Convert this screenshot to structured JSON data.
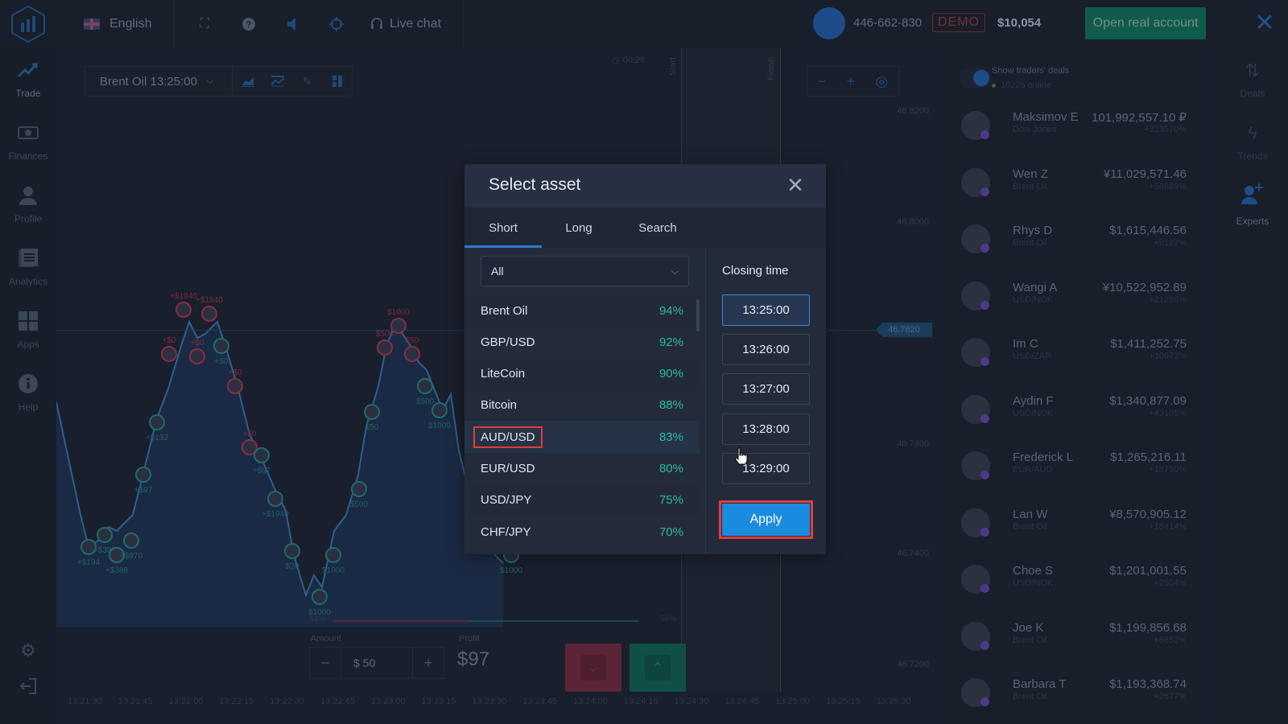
{
  "topbar": {
    "language": "English",
    "live_chat": "Live chat",
    "account_id": "446-662-830",
    "account_mode": "DEMO",
    "balance": "$10,054",
    "open_real_account": "Open real account",
    "icons": [
      "logo-icon",
      "flag-uk-icon",
      "fullscreen-icon",
      "help-icon",
      "sound-icon",
      "target-icon",
      "headset-icon",
      "close-icon"
    ]
  },
  "sidebar": {
    "items": [
      {
        "label": "Trade",
        "icon": "trade-icon",
        "active": true
      },
      {
        "label": "Finances",
        "icon": "finances-icon"
      },
      {
        "label": "Profile",
        "icon": "profile-icon"
      },
      {
        "label": "Analytics",
        "icon": "analytics-icon"
      },
      {
        "label": "Apps",
        "icon": "apps-icon"
      },
      {
        "label": "Help",
        "icon": "help-icon"
      }
    ],
    "bottom_icons": [
      "settings-icon",
      "logout-icon"
    ]
  },
  "chart": {
    "asset_selector": "Brent Oil 13:25:00",
    "timer": "00:26",
    "start_label": "Start",
    "finish_label": "Finish",
    "current_price": "46.7820",
    "price_labels": [
      "46.8200",
      "46.8000",
      "46.7600",
      "46.7400",
      "46.7200"
    ],
    "time_labels": [
      "13:21:30",
      "13:21:45",
      "13:22:00",
      "13:22:15",
      "13:22:30",
      "13:22:45",
      "13:23:00",
      "13:23:15",
      "13:23:30",
      "13:23:45",
      "13:24:00",
      "13:24:15",
      "13:24:30",
      "13:24:45",
      "13:25:00",
      "13:25:15",
      "13:25:30"
    ],
    "deal_labels": [
      {
        "text": "+$1940",
        "kind": "down"
      },
      {
        "text": "+$1940",
        "kind": "down"
      },
      {
        "text": "+$0",
        "kind": "down"
      },
      {
        "text": "+$0",
        "kind": "down"
      },
      {
        "text": "+$0",
        "kind": "up"
      },
      {
        "text": "+$0",
        "kind": "down"
      },
      {
        "text": "+$132",
        "kind": "up"
      },
      {
        "text": "+$97",
        "kind": "up"
      },
      {
        "text": "+$194",
        "kind": "up"
      },
      {
        "text": "+$388",
        "kind": "up"
      },
      {
        "text": "+$388",
        "kind": "up"
      },
      {
        "text": "+$970",
        "kind": "up"
      },
      {
        "text": "+$0",
        "kind": "down"
      },
      {
        "text": "+$97",
        "kind": "up"
      },
      {
        "text": "+$1940",
        "kind": "up"
      },
      {
        "text": "$20",
        "kind": "up"
      },
      {
        "text": "$1000",
        "kind": "down"
      },
      {
        "text": "$500",
        "kind": "down"
      },
      {
        "text": "$50",
        "kind": "down"
      },
      {
        "text": "$50",
        "kind": "up"
      },
      {
        "text": "$500",
        "kind": "up"
      },
      {
        "text": "$1000",
        "kind": "up"
      },
      {
        "text": "$500",
        "kind": "up"
      },
      {
        "text": "$1000",
        "kind": "up"
      },
      {
        "text": "$1000",
        "kind": "up"
      },
      {
        "text": "$1000",
        "kind": "up"
      }
    ],
    "sentiment": {
      "down_percent": 44,
      "up_percent": 56,
      "down_label": "44%",
      "up_label": "56%"
    },
    "amount_label": "Amount",
    "amount_value": "$ 50",
    "profit_label": "Profit",
    "profit_value": "$97",
    "minus": "−",
    "plus": "+"
  },
  "traders_panel": {
    "show_deals": "Show traders' deals",
    "online": "10225 online",
    "toggle_on": true,
    "traders": [
      {
        "name": "Maksimov E",
        "asset": "Dow Jones",
        "amount": "101,992,557.10 ₽",
        "percent": "+323570%"
      },
      {
        "name": "Wen Z",
        "asset": "Brent Oil",
        "amount": "¥11,029,571.46",
        "percent": "+58689%"
      },
      {
        "name": "Rhys D",
        "asset": "Brent Oil",
        "amount": "$1,615,446.56",
        "percent": "+9127%"
      },
      {
        "name": "Wangi A",
        "asset": "USD/NOK",
        "amount": "¥10,522,952.89",
        "percent": "+21296%"
      },
      {
        "name": "Im C",
        "asset": "USD/ZAR",
        "amount": "$1,411,252.75",
        "percent": "+10973%"
      },
      {
        "name": "Aydin F",
        "asset": "USD/NOK",
        "amount": "$1,340,877.09",
        "percent": "+43105%"
      },
      {
        "name": "Frederick L",
        "asset": "EUR/AUD",
        "amount": "$1,265,216.11",
        "percent": "+18790%"
      },
      {
        "name": "Lan W",
        "asset": "Brent Oil",
        "amount": "¥8,570,905.12",
        "percent": "+18414%"
      },
      {
        "name": "Choe S",
        "asset": "USD/NOK",
        "amount": "$1,201,001.55",
        "percent": "+2504%"
      },
      {
        "name": "Joe K",
        "asset": "Brent Oil",
        "amount": "$1,199,856.68",
        "percent": "+6652%"
      },
      {
        "name": "Barbara T",
        "asset": "Brent Oil",
        "amount": "$1,193,368.74",
        "percent": "+2677%"
      }
    ]
  },
  "rightbar": {
    "items": [
      {
        "label": "Deals",
        "icon": "deals-icon"
      },
      {
        "label": "Trends",
        "icon": "trends-icon"
      },
      {
        "label": "Experts",
        "icon": "experts-icon",
        "active": true
      }
    ]
  },
  "modal": {
    "title": "Select asset",
    "tabs": [
      {
        "label": "Short",
        "active": true
      },
      {
        "label": "Long"
      },
      {
        "label": "Search"
      }
    ],
    "filter_value": "All",
    "assets": [
      {
        "name": "Brent Oil",
        "percent": "94%"
      },
      {
        "name": "GBP/USD",
        "percent": "92%"
      },
      {
        "name": "LiteCoin",
        "percent": "90%"
      },
      {
        "name": "Bitcoin",
        "percent": "88%"
      },
      {
        "name": "AUD/USD",
        "percent": "83%",
        "selected": true
      },
      {
        "name": "EUR/USD",
        "percent": "80%"
      },
      {
        "name": "USD/JPY",
        "percent": "75%"
      },
      {
        "name": "CHF/JPY",
        "percent": "70%"
      }
    ],
    "closing_time_label": "Closing time",
    "closing_times": [
      {
        "time": "13:25:00",
        "selected": true
      },
      {
        "time": "13:26:00"
      },
      {
        "time": "13:27:00"
      },
      {
        "time": "13:28:00"
      },
      {
        "time": "13:29:00"
      }
    ],
    "apply_label": "Apply"
  },
  "colors": {
    "accent": "#1b8be0",
    "profit_green": "#2eb8a4",
    "highlight_red": "#e23b3b",
    "demo_red": "#7a2f38",
    "open_account_green": "#0f5a4b"
  }
}
